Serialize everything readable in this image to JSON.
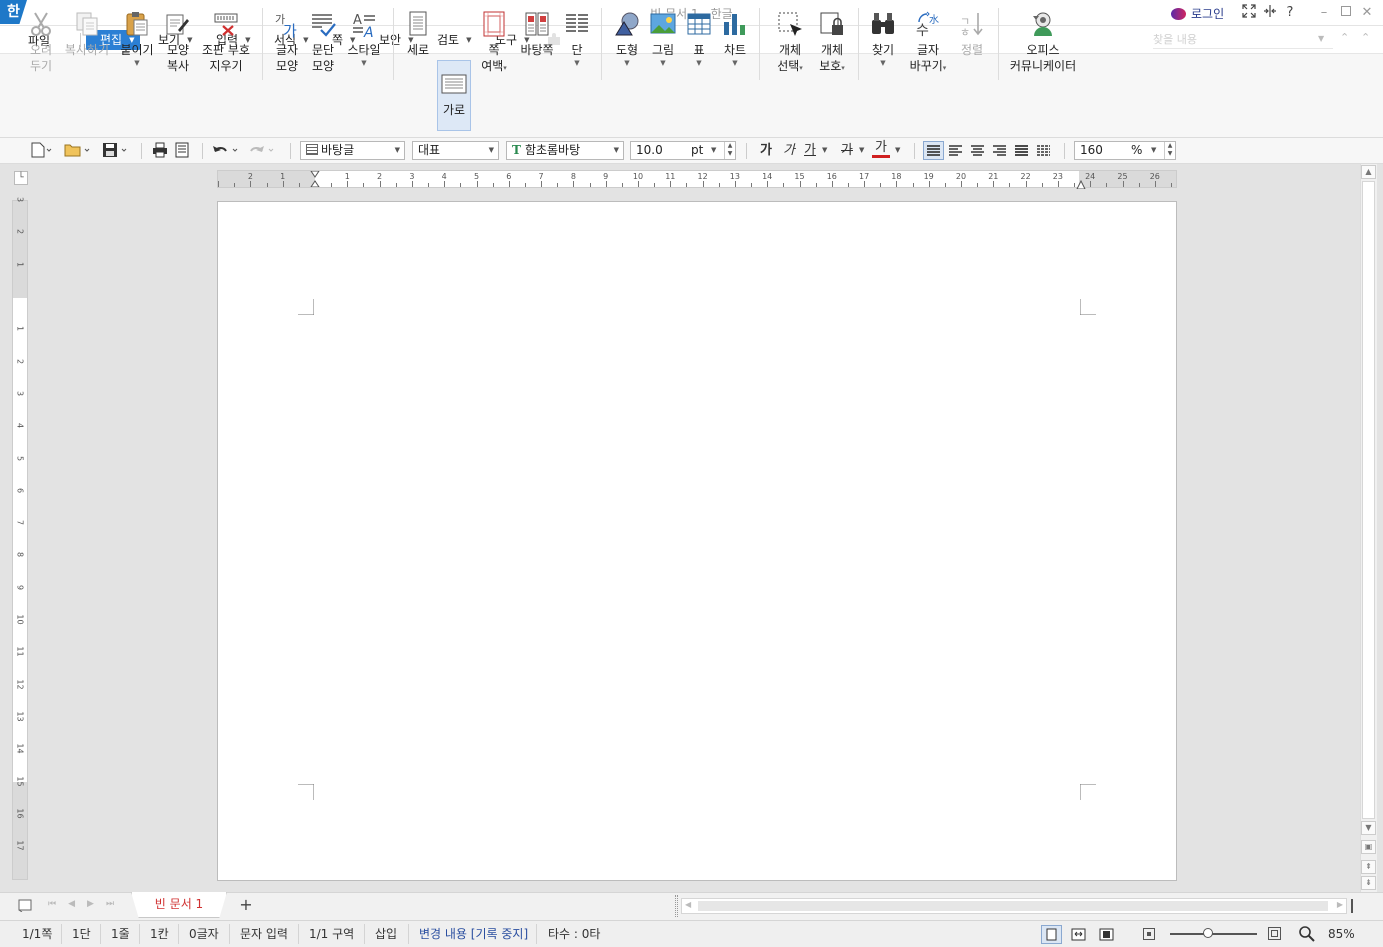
{
  "titlebar": {
    "app_icon_letter": "한",
    "title": "빈 문서 1 - 한글",
    "login": "로그인",
    "help": "?"
  },
  "menus": {
    "file": "파일",
    "edit": "편집",
    "view": "보기",
    "insert": "입력",
    "format": "서식",
    "page": "쪽",
    "security": "보안",
    "review": "검토",
    "tools": "도구"
  },
  "find": {
    "placeholder": "찾을 내용"
  },
  "ribbon": {
    "cut": [
      "오려",
      "두기"
    ],
    "copy": "복사하기",
    "paste": "붙이기",
    "format_copy": [
      "모양",
      "복사"
    ],
    "clear_code": [
      "조판 부호",
      "지우기"
    ],
    "char_shape": [
      "글자",
      "모양"
    ],
    "para_shape": [
      "문단",
      "모양"
    ],
    "style": "스타일",
    "portrait": "세로",
    "landscape": "가로",
    "margin": [
      "쪽",
      "여백"
    ],
    "master_page": "바탕쪽",
    "columns": "단",
    "shape": "도형",
    "picture": "그림",
    "table": "표",
    "chart": "차트",
    "obj_select": [
      "개체",
      "선택"
    ],
    "obj_protect": [
      "개체",
      "보호"
    ],
    "find": "찾기",
    "replace": [
      "글자",
      "바꾸기"
    ],
    "sort": "정렬",
    "communicator": [
      "오피스",
      "커뮤니케이터"
    ]
  },
  "toolbar2": {
    "style_name": "바탕글",
    "lang": "대표",
    "font": "함초롬바탕",
    "size": "10.0",
    "unit": "pt",
    "bold": "가",
    "italic": "가",
    "underline": "가",
    "strike": "가",
    "color": "가",
    "zoom": "160",
    "zoom_unit": "%"
  },
  "ruler": {
    "h": [
      "2",
      "1",
      "1",
      "2",
      "3",
      "4",
      "5",
      "6",
      "7",
      "8",
      "9",
      "10",
      "11",
      "12",
      "13",
      "14",
      "15",
      "16",
      "17",
      "18",
      "19",
      "20",
      "21",
      "22",
      "23",
      "24",
      "25",
      "26"
    ],
    "v": [
      "3",
      "2",
      "1",
      "1",
      "2",
      "3",
      "4",
      "5",
      "6",
      "7",
      "8",
      "9",
      "10",
      "11",
      "12",
      "13",
      "14",
      "15",
      "16",
      "17"
    ]
  },
  "tabs": {
    "doc": "빈 문서 1",
    "add": "+"
  },
  "status": {
    "page": "1/1쪽",
    "column": "1단",
    "line": "1줄",
    "cell": "1칸",
    "chars": "0글자",
    "mode": "문자 입력",
    "section": "1/1 구역",
    "insert": "삽입",
    "track": "변경 내용 [기록 중지]",
    "typing": "타수 : 0타",
    "zoom": "85%"
  }
}
